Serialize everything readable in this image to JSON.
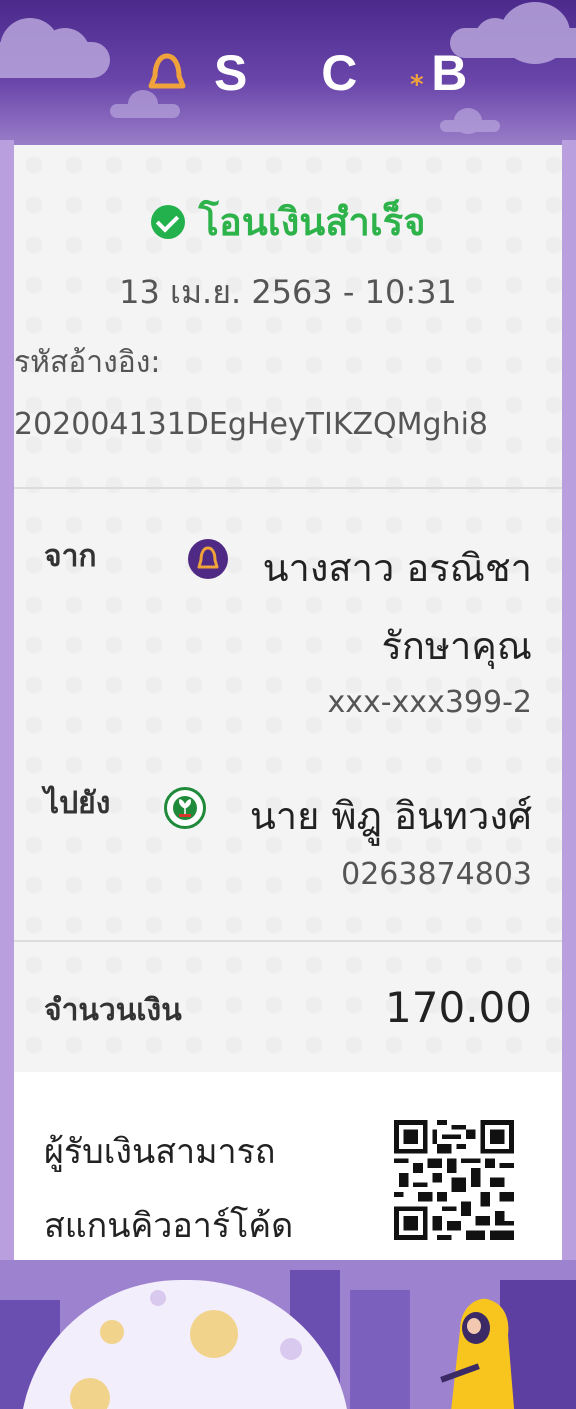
{
  "header": {
    "brand": "S C B"
  },
  "receipt": {
    "status": "โอนเงินสำเร็จ",
    "datetime": "13 เม.ย. 2563 - 10:31",
    "ref_label": "รหัสอ้างอิง:",
    "ref_code": "202004131DEgHeyTIKZQMghi8",
    "from": {
      "label": "จาก",
      "name_line1": "นางสาว อรณิชา",
      "name_line2": "รักษาคุณ",
      "account": "xxx-xxx399-2"
    },
    "to": {
      "label": "ไปยัง",
      "name": "นาย พิฎู อินทวงศ์",
      "account": "0263874803"
    },
    "amount": {
      "label": "จำนวนเงิน",
      "value": "170.00"
    },
    "qr": {
      "line1": "ผู้รับเงินสามารถ",
      "line2": "สแกนคิวอาร์โค้ด"
    }
  },
  "colors": {
    "brand_purple": "#4b2a8c",
    "success_green": "#2eb24a",
    "kbank_green": "#1f8a3a",
    "scb_gold": "#f0a33a"
  },
  "icons": [
    "scb-logo-icon",
    "check-circle-icon",
    "scb-bank-icon",
    "kbank-icon",
    "qr-code"
  ]
}
